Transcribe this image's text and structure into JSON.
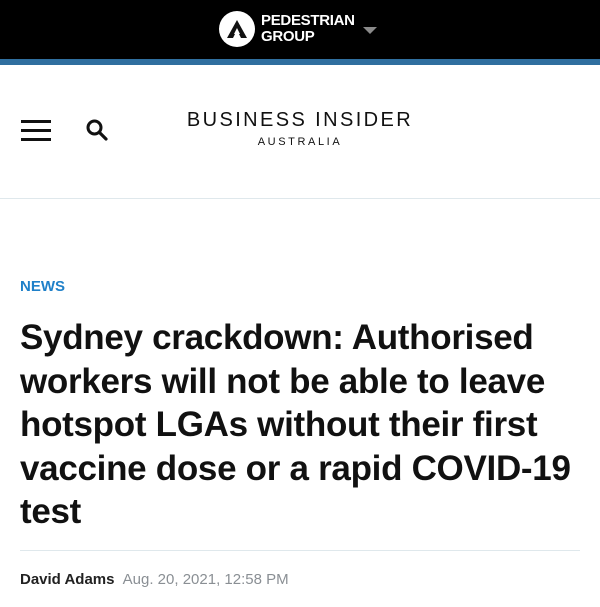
{
  "topbar": {
    "logo_line1": "PEDESTRIAN",
    "logo_line2": "GROUP",
    "logo_icon": "pedestrian-group-logo",
    "caret_icon": "caret-down-icon"
  },
  "header": {
    "menu_icon": "hamburger-menu-icon",
    "search_icon": "search-icon",
    "brand_main": "BUSINESS INSIDER",
    "brand_sub": "AUSTRALIA"
  },
  "article": {
    "category": "NEWS",
    "headline": "Sydney crackdown: Authorised workers will not be able to leave hotspot LGAs without their first vaccine dose or a rapid COVID-19 test",
    "author": "David Adams",
    "date": "Aug. 20, 2021, 12:58 PM"
  },
  "colors": {
    "topbar_bg": "#000000",
    "accent_bar": "#2f6f9f",
    "category_blue": "#1f80c9",
    "date_gray": "#8a8f94"
  }
}
